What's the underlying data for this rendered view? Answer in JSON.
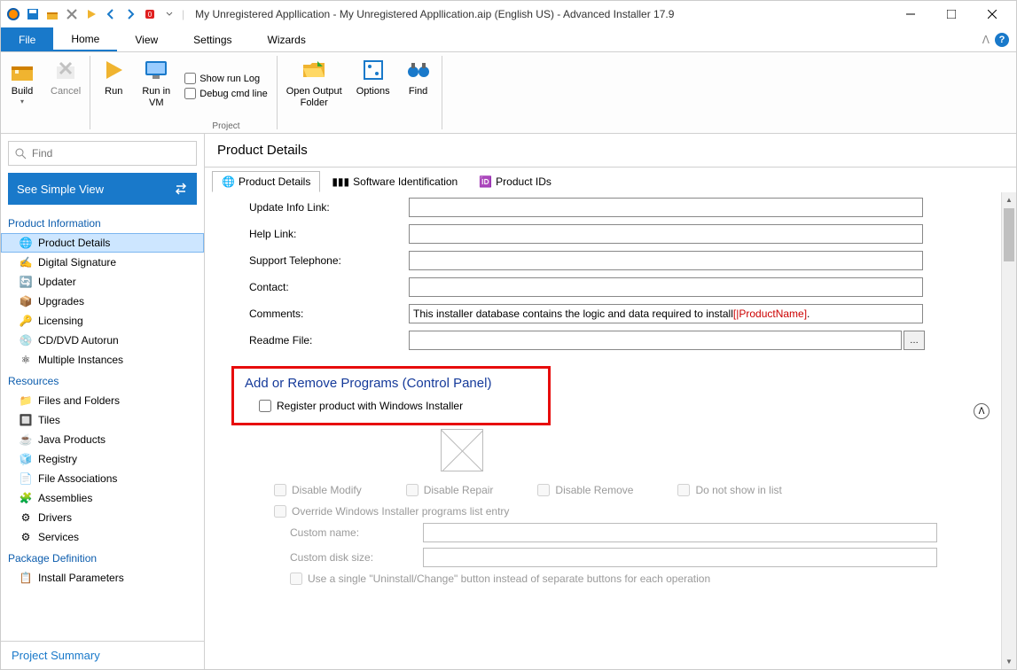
{
  "title": "My Unregistered Appllication - My Unregistered Appllication.aip (English US) - Advanced Installer 17.9",
  "file_tab": "File",
  "menu_tabs": [
    "Home",
    "View",
    "Settings",
    "Wizards"
  ],
  "ribbon": {
    "build": "Build",
    "cancel": "Cancel",
    "run": "Run",
    "run_vm": "Run in\nVM",
    "show_run_log": "Show run Log",
    "debug_cmd": "Debug cmd line",
    "project_group": "Project",
    "open_output": "Open Output\nFolder",
    "options": "Options",
    "find": "Find"
  },
  "leftnav": {
    "find_placeholder": "Find",
    "simple_view": "See Simple View",
    "sections": {
      "product_info": "Product Information",
      "resources": "Resources",
      "package_def": "Package Definition"
    },
    "product_info_items": [
      "Product Details",
      "Digital Signature",
      "Updater",
      "Upgrades",
      "Licensing",
      "CD/DVD Autorun",
      "Multiple Instances"
    ],
    "resources_items": [
      "Files and Folders",
      "Tiles",
      "Java Products",
      "Registry",
      "File Associations",
      "Assemblies",
      "Drivers",
      "Services"
    ],
    "package_def_items": [
      "Install Parameters"
    ],
    "footer": "Project Summary"
  },
  "main": {
    "header": "Product Details",
    "tabs": [
      "Product Details",
      "Software Identification",
      "Product IDs"
    ],
    "fields": {
      "update_info": "Update Info Link:",
      "help_link": "Help Link:",
      "support_tel": "Support Telephone:",
      "contact": "Contact:",
      "comments": "Comments:",
      "comments_prefix": "This installer database contains the logic and data required to install ",
      "comments_ref": "[|ProductName]",
      "comments_suffix": ".",
      "readme": "Readme File:"
    },
    "arp": {
      "title": "Add or Remove Programs (Control Panel)",
      "register": "Register product with Windows Installer",
      "disable_modify": "Disable Modify",
      "disable_repair": "Disable Repair",
      "disable_remove": "Disable Remove",
      "do_not_show": "Do not show in list",
      "override": "Override Windows Installer programs list entry",
      "custom_name": "Custom name:",
      "custom_disk": "Custom disk size:",
      "single_btn": "Use a single \"Uninstall/Change\" button instead of separate buttons for each operation"
    }
  }
}
